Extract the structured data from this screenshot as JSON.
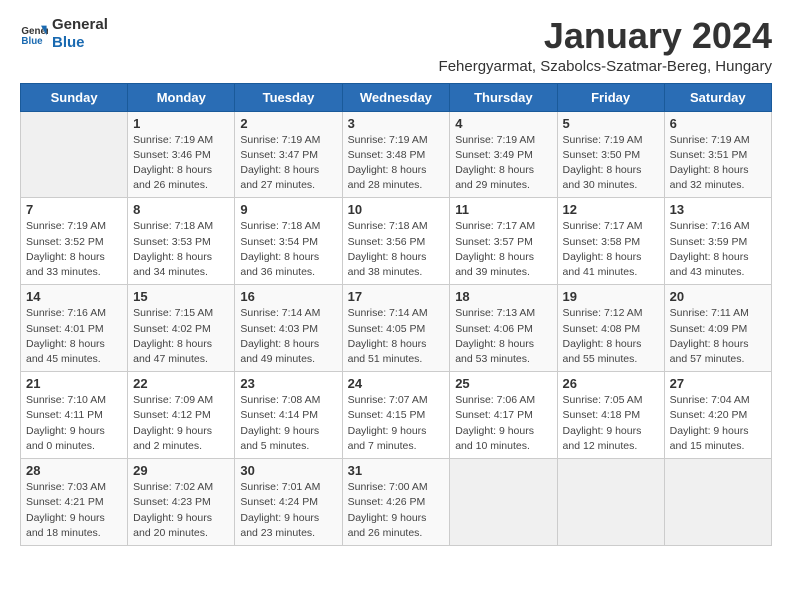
{
  "header": {
    "logo_line1": "General",
    "logo_line2": "Blue",
    "title": "January 2024",
    "subtitle": "Fehergyarmat, Szabolcs-Szatmar-Bereg, Hungary"
  },
  "calendar": {
    "days_of_week": [
      "Sunday",
      "Monday",
      "Tuesday",
      "Wednesday",
      "Thursday",
      "Friday",
      "Saturday"
    ],
    "weeks": [
      [
        {
          "day": "",
          "info": ""
        },
        {
          "day": "1",
          "info": "Sunrise: 7:19 AM\nSunset: 3:46 PM\nDaylight: 8 hours\nand 26 minutes."
        },
        {
          "day": "2",
          "info": "Sunrise: 7:19 AM\nSunset: 3:47 PM\nDaylight: 8 hours\nand 27 minutes."
        },
        {
          "day": "3",
          "info": "Sunrise: 7:19 AM\nSunset: 3:48 PM\nDaylight: 8 hours\nand 28 minutes."
        },
        {
          "day": "4",
          "info": "Sunrise: 7:19 AM\nSunset: 3:49 PM\nDaylight: 8 hours\nand 29 minutes."
        },
        {
          "day": "5",
          "info": "Sunrise: 7:19 AM\nSunset: 3:50 PM\nDaylight: 8 hours\nand 30 minutes."
        },
        {
          "day": "6",
          "info": "Sunrise: 7:19 AM\nSunset: 3:51 PM\nDaylight: 8 hours\nand 32 minutes."
        }
      ],
      [
        {
          "day": "7",
          "info": "Sunrise: 7:19 AM\nSunset: 3:52 PM\nDaylight: 8 hours\nand 33 minutes."
        },
        {
          "day": "8",
          "info": "Sunrise: 7:18 AM\nSunset: 3:53 PM\nDaylight: 8 hours\nand 34 minutes."
        },
        {
          "day": "9",
          "info": "Sunrise: 7:18 AM\nSunset: 3:54 PM\nDaylight: 8 hours\nand 36 minutes."
        },
        {
          "day": "10",
          "info": "Sunrise: 7:18 AM\nSunset: 3:56 PM\nDaylight: 8 hours\nand 38 minutes."
        },
        {
          "day": "11",
          "info": "Sunrise: 7:17 AM\nSunset: 3:57 PM\nDaylight: 8 hours\nand 39 minutes."
        },
        {
          "day": "12",
          "info": "Sunrise: 7:17 AM\nSunset: 3:58 PM\nDaylight: 8 hours\nand 41 minutes."
        },
        {
          "day": "13",
          "info": "Sunrise: 7:16 AM\nSunset: 3:59 PM\nDaylight: 8 hours\nand 43 minutes."
        }
      ],
      [
        {
          "day": "14",
          "info": "Sunrise: 7:16 AM\nSunset: 4:01 PM\nDaylight: 8 hours\nand 45 minutes."
        },
        {
          "day": "15",
          "info": "Sunrise: 7:15 AM\nSunset: 4:02 PM\nDaylight: 8 hours\nand 47 minutes."
        },
        {
          "day": "16",
          "info": "Sunrise: 7:14 AM\nSunset: 4:03 PM\nDaylight: 8 hours\nand 49 minutes."
        },
        {
          "day": "17",
          "info": "Sunrise: 7:14 AM\nSunset: 4:05 PM\nDaylight: 8 hours\nand 51 minutes."
        },
        {
          "day": "18",
          "info": "Sunrise: 7:13 AM\nSunset: 4:06 PM\nDaylight: 8 hours\nand 53 minutes."
        },
        {
          "day": "19",
          "info": "Sunrise: 7:12 AM\nSunset: 4:08 PM\nDaylight: 8 hours\nand 55 minutes."
        },
        {
          "day": "20",
          "info": "Sunrise: 7:11 AM\nSunset: 4:09 PM\nDaylight: 8 hours\nand 57 minutes."
        }
      ],
      [
        {
          "day": "21",
          "info": "Sunrise: 7:10 AM\nSunset: 4:11 PM\nDaylight: 9 hours\nand 0 minutes."
        },
        {
          "day": "22",
          "info": "Sunrise: 7:09 AM\nSunset: 4:12 PM\nDaylight: 9 hours\nand 2 minutes."
        },
        {
          "day": "23",
          "info": "Sunrise: 7:08 AM\nSunset: 4:14 PM\nDaylight: 9 hours\nand 5 minutes."
        },
        {
          "day": "24",
          "info": "Sunrise: 7:07 AM\nSunset: 4:15 PM\nDaylight: 9 hours\nand 7 minutes."
        },
        {
          "day": "25",
          "info": "Sunrise: 7:06 AM\nSunset: 4:17 PM\nDaylight: 9 hours\nand 10 minutes."
        },
        {
          "day": "26",
          "info": "Sunrise: 7:05 AM\nSunset: 4:18 PM\nDaylight: 9 hours\nand 12 minutes."
        },
        {
          "day": "27",
          "info": "Sunrise: 7:04 AM\nSunset: 4:20 PM\nDaylight: 9 hours\nand 15 minutes."
        }
      ],
      [
        {
          "day": "28",
          "info": "Sunrise: 7:03 AM\nSunset: 4:21 PM\nDaylight: 9 hours\nand 18 minutes."
        },
        {
          "day": "29",
          "info": "Sunrise: 7:02 AM\nSunset: 4:23 PM\nDaylight: 9 hours\nand 20 minutes."
        },
        {
          "day": "30",
          "info": "Sunrise: 7:01 AM\nSunset: 4:24 PM\nDaylight: 9 hours\nand 23 minutes."
        },
        {
          "day": "31",
          "info": "Sunrise: 7:00 AM\nSunset: 4:26 PM\nDaylight: 9 hours\nand 26 minutes."
        },
        {
          "day": "",
          "info": ""
        },
        {
          "day": "",
          "info": ""
        },
        {
          "day": "",
          "info": ""
        }
      ]
    ]
  }
}
